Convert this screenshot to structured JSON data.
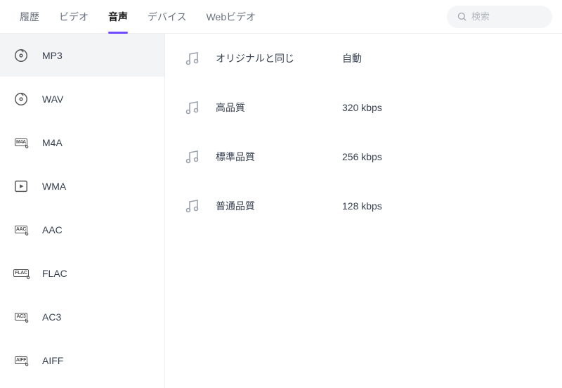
{
  "tabs": [
    {
      "label": "履歴",
      "active": false
    },
    {
      "label": "ビデオ",
      "active": false
    },
    {
      "label": "音声",
      "active": true
    },
    {
      "label": "デバイス",
      "active": false
    },
    {
      "label": "Webビデオ",
      "active": false
    }
  ],
  "search": {
    "placeholder": "検索"
  },
  "formats": [
    {
      "code": "MP3",
      "icon": "disc",
      "selected": true
    },
    {
      "code": "WAV",
      "icon": "disc",
      "selected": false
    },
    {
      "code": "M4A",
      "icon": "badge",
      "selected": false
    },
    {
      "code": "WMA",
      "icon": "play",
      "selected": false
    },
    {
      "code": "AAC",
      "icon": "badge",
      "selected": false
    },
    {
      "code": "FLAC",
      "icon": "badge",
      "selected": false
    },
    {
      "code": "AC3",
      "icon": "badge",
      "selected": false
    },
    {
      "code": "AIFF",
      "icon": "badge",
      "selected": false
    }
  ],
  "qualities": [
    {
      "name": "オリジナルと同じ",
      "value": "自動"
    },
    {
      "name": "高品質",
      "value": "320 kbps"
    },
    {
      "name": "標準品質",
      "value": "256 kbps"
    },
    {
      "name": "普通品質",
      "value": "128 kbps"
    }
  ]
}
